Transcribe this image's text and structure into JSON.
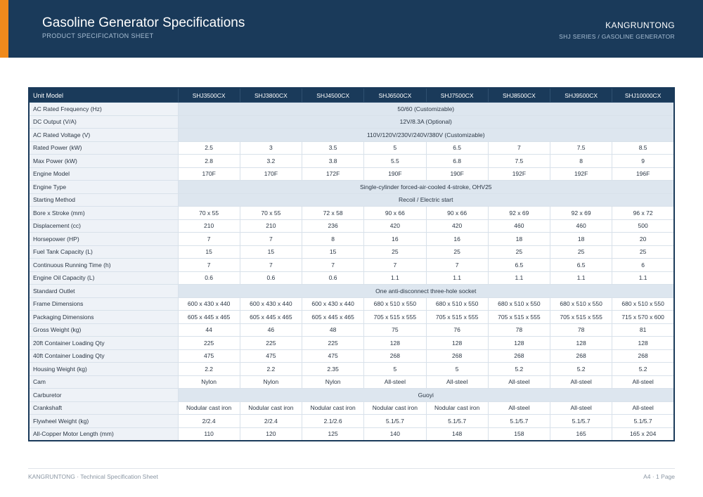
{
  "header": {
    "title": "Gasoline Generator Specifications",
    "subtitle": "PRODUCT SPECIFICATION SHEET",
    "brand": "KANGRUNTONG",
    "series": "SHJ SERIES / GASOLINE GENERATOR"
  },
  "colors": {
    "header_bg": "#1a3a5a",
    "accent": "#f08a1c",
    "label_bg": "#eef2f7",
    "merged_bg": "#dde6ef"
  },
  "table": {
    "corner_label": "Unit Model",
    "models": [
      "SHJ3500CX",
      "SHJ3800CX",
      "SHJ4500CX",
      "SHJ6500CX",
      "SHJ7500CX",
      "SHJ8500CX",
      "SHJ9500CX",
      "SHJ10000CX"
    ],
    "rows": [
      {
        "label": "AC Rated Frequency (Hz)",
        "merged": "50/60 (Customizable)"
      },
      {
        "label": "DC Output (V/A)",
        "merged": "12V/8.3A (Optional)"
      },
      {
        "label": "AC Rated Voltage (V)",
        "merged": "110V/120V/230V/240V/380V (Customizable)"
      },
      {
        "label": "Rated Power (kW)",
        "values": [
          "2.5",
          "3",
          "3.5",
          "5",
          "6.5",
          "7",
          "7.5",
          "8.5"
        ]
      },
      {
        "label": "Max Power (kW)",
        "values": [
          "2.8",
          "3.2",
          "3.8",
          "5.5",
          "6.8",
          "7.5",
          "8",
          "9"
        ]
      },
      {
        "label": "Engine Model",
        "values": [
          "170F",
          "170F",
          "172F",
          "190F",
          "190F",
          "192F",
          "192F",
          "196F"
        ]
      },
      {
        "label": "Engine Type",
        "merged": "Single-cylinder forced-air-cooled 4-stroke, OHV25"
      },
      {
        "label": "Starting Method",
        "merged": "Recoil / Electric start"
      },
      {
        "label": "Bore x Stroke (mm)",
        "values": [
          "70 x 55",
          "70 x 55",
          "72 x 58",
          "90 x 66",
          "90 x 66",
          "92 x 69",
          "92 x 69",
          "96 x 72"
        ]
      },
      {
        "label": "Displacement (cc)",
        "values": [
          "210",
          "210",
          "236",
          "420",
          "420",
          "460",
          "460",
          "500"
        ]
      },
      {
        "label": "Horsepower (HP)",
        "values": [
          "7",
          "7",
          "8",
          "16",
          "16",
          "18",
          "18",
          "20"
        ]
      },
      {
        "label": "Fuel Tank Capacity (L)",
        "values": [
          "15",
          "15",
          "15",
          "25",
          "25",
          "25",
          "25",
          "25"
        ]
      },
      {
        "label": "Continuous Running Time (h)",
        "values": [
          "7",
          "7",
          "7",
          "7",
          "7",
          "6.5",
          "6.5",
          "6"
        ]
      },
      {
        "label": "Engine Oil Capacity (L)",
        "values": [
          "0.6",
          "0.6",
          "0.6",
          "1.1",
          "1.1",
          "1.1",
          "1.1",
          "1.1"
        ]
      },
      {
        "label": "Standard Outlet",
        "merged": "One anti-disconnect three-hole socket"
      },
      {
        "label": "Frame Dimensions",
        "values": [
          "600 x 430 x 440",
          "600 x 430 x 440",
          "600 x 430 x 440",
          "680 x 510 x 550",
          "680 x 510 x 550",
          "680 x 510 x 550",
          "680 x 510 x 550",
          "680 x 510 x 550"
        ]
      },
      {
        "label": "Packaging Dimensions",
        "values": [
          "605 x 445 x 465",
          "605 x 445 x 465",
          "605 x 445 x 465",
          "705 x 515 x 555",
          "705 x 515 x 555",
          "705 x 515 x 555",
          "705 x 515 x 555",
          "715 x 570 x 600"
        ]
      },
      {
        "label": "Gross Weight (kg)",
        "values": [
          "44",
          "46",
          "48",
          "75",
          "76",
          "78",
          "78",
          "81"
        ]
      },
      {
        "label": "20ft Container Loading Qty",
        "values": [
          "225",
          "225",
          "225",
          "128",
          "128",
          "128",
          "128",
          "128"
        ]
      },
      {
        "label": "40ft Container Loading Qty",
        "values": [
          "475",
          "475",
          "475",
          "268",
          "268",
          "268",
          "268",
          "268"
        ]
      },
      {
        "label": "Housing Weight (kg)",
        "values": [
          "2.2",
          "2.2",
          "2.35",
          "5",
          "5",
          "5.2",
          "5.2",
          "5.2"
        ]
      },
      {
        "label": "Cam",
        "values": [
          "Nylon",
          "Nylon",
          "Nylon",
          "All-steel",
          "All-steel",
          "All-steel",
          "All-steel",
          "All-steel"
        ]
      },
      {
        "label": "Carburetor",
        "merged": "Guoyi"
      },
      {
        "label": "Crankshaft",
        "values": [
          "Nodular cast iron",
          "Nodular cast iron",
          "Nodular cast iron",
          "Nodular cast iron",
          "Nodular cast iron",
          "All-steel",
          "All-steel",
          "All-steel"
        ]
      },
      {
        "label": "Flywheel Weight (kg)",
        "values": [
          "2/2.4",
          "2/2.4",
          "2.1/2.6",
          "5.1/5.7",
          "5.1/5.7",
          "5.1/5.7",
          "5.1/5.7",
          "5.1/5.7"
        ]
      },
      {
        "label": "All-Copper Motor Length (mm)",
        "values": [
          "110",
          "120",
          "125",
          "140",
          "148",
          "158",
          "165",
          "165 x 204"
        ]
      }
    ]
  },
  "footer": {
    "left": "KANGRUNTONG  ·  Technical Specification Sheet",
    "right": "A4  ·  1 Page"
  }
}
